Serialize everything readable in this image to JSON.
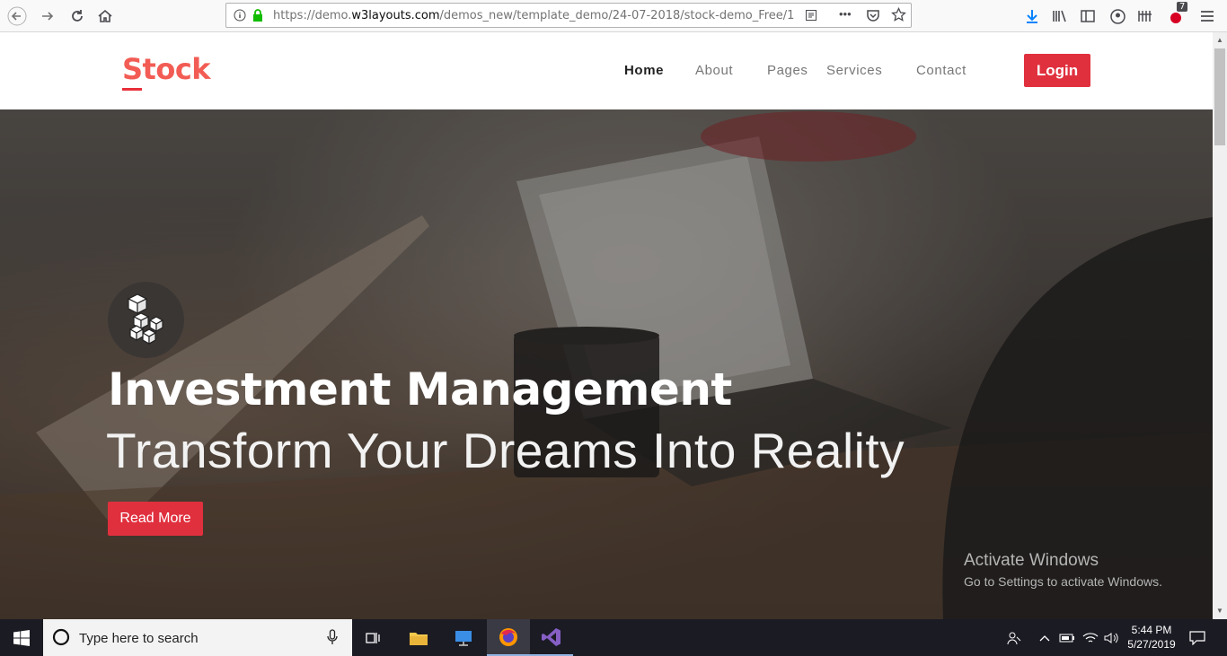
{
  "browser": {
    "url_prefix": "https://demo.",
    "url_domain": "w3layouts.com",
    "url_path": "/demos_new/template_demo/24-07-2018/stock-demo_Free/1",
    "more_label": "•••",
    "notification_count": "7"
  },
  "site": {
    "logo": "Stock",
    "nav": [
      "Home",
      "About",
      "Pages",
      "Services",
      "Contact"
    ],
    "login_label": "Login"
  },
  "hero": {
    "title": "Investment Management",
    "subtitle": "Transform Your Dreams Into Reality",
    "button_label": "Read More"
  },
  "watermark": {
    "title": "Activate Windows",
    "subtitle": "Go to Settings to activate Windows."
  },
  "taskbar": {
    "search_placeholder": "Type here to search",
    "time": "5:44 PM",
    "date": "5/27/2019"
  },
  "colors": {
    "accent": "#e0303e",
    "logo": "#f25c54",
    "taskbar": "#1b1b24"
  }
}
